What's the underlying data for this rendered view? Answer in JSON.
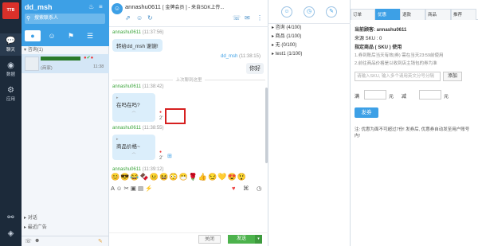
{
  "nav": {
    "logo_text": "TTB",
    "items": [
      {
        "label": "聊天",
        "icon": "chat-icon"
      },
      {
        "label": "数据",
        "icon": "data-icon"
      },
      {
        "label": "应用",
        "icon": "apps-icon"
      }
    ]
  },
  "contacts": {
    "user_name": "dd_msh",
    "search_placeholder": "搜索联系人",
    "section_label": "咨询(1)",
    "item": {
      "sub": "(商家)",
      "time": "11:38",
      "name_placeholder": " "
    },
    "bottom_links": [
      "对话",
      "最近广告"
    ]
  },
  "chat": {
    "contact_name": "annashu0611",
    "contact_sub": "[ 金牌会员 ] - 来自SDK上传...",
    "messages": {
      "m1_meta": "annashu0611",
      "m1_time": "(11:37:56)",
      "m1_text": "转给dd_msh 谢谢!",
      "m2_meta": "dd_msh",
      "m2_time": "(11:38:15)",
      "m2_text": "你好",
      "sys_text": "上次聊到这里",
      "m3_meta": "annashu0611",
      "m3_time": "(11:38:42)",
      "m3_text": "在吗在吗?",
      "m3_tag": "2'",
      "m4_meta": "annashu0611",
      "m4_time": "(11:38:55)",
      "m4_text": "商品价格~",
      "m4_tag": "2'",
      "m5_meta": "annashu0611",
      "m5_time": "(11:39:12)"
    },
    "emojis": "😊😎😂🍫😐😆😳😷🌹👍😏💛😍😲",
    "close_label": "关闭",
    "send_label": "发送"
  },
  "groups": {
    "items": [
      {
        "label": "▸ 咨询 (4/100)"
      },
      {
        "label": "▸ 商品 (1/100)"
      },
      {
        "label": "▸ 无 (0/100)"
      },
      {
        "label": "▸ test1 (1/100)"
      }
    ]
  },
  "right": {
    "tabs": [
      "订单",
      "优惠",
      "退款",
      "商品",
      "推荐"
    ],
    "rows": {
      "buyer": "当前顾客: annashu0611",
      "sku": "来源 SKU : 0",
      "assign": "指定商品 ( SKU ) 使用",
      "note1": "1.券到账后当天有效(券) 需在当天23:59前使用",
      "note2": "2.前往商品价格是以收到店主钱包的券为准",
      "coupon_placeholder": "请输入SKU, 输入多个请用英文分号分隔",
      "add_label": "添加",
      "full_label": "满",
      "yuan1": "元",
      "minus_label": "减",
      "yuan2": "元",
      "issue_label": "发券",
      "footnote": "注: 优惠为面不可超过7份! 发券后, 优惠券自动发至用户账号内!"
    }
  },
  "colors": {
    "accent": "#3da0e6",
    "send_green": "#4cb24c",
    "nav_dark": "#1c2a3a",
    "highlight_red": "#d62020"
  }
}
